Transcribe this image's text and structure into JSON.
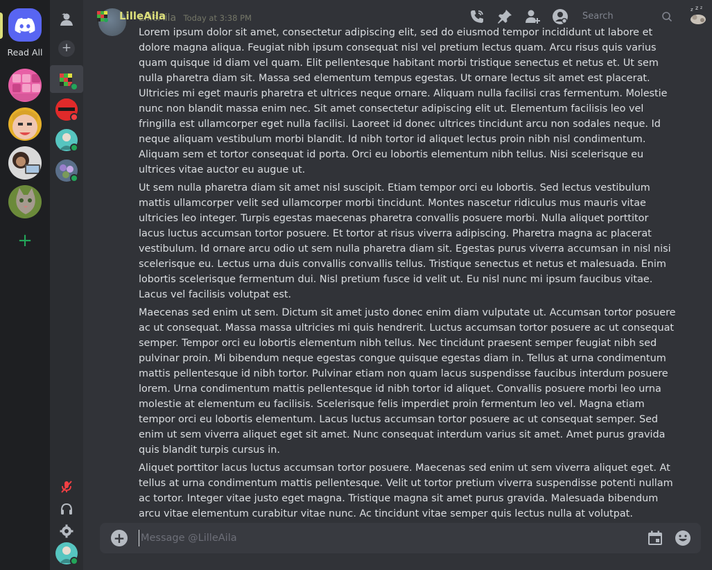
{
  "rail": {
    "read_all_label": "Read All",
    "accent": "#dbde7a",
    "brand": "#5865f2"
  },
  "header": {
    "username": "LilleAila",
    "search_placeholder": "Search",
    "icons": [
      "phone-call-icon",
      "pin-icon",
      "add-friend-icon",
      "profile-icon",
      "search-icon",
      "sleep-zz-icon"
    ]
  },
  "message": {
    "author": "LilleAila",
    "timestamp": "Today at 3:38 PM",
    "paragraphs": [
      "Lorem ipsum dolor sit amet, consectetur adipiscing elit, sed do eiusmod tempor incididunt ut labore et dolore magna aliqua. Feugiat nibh ipsum consequat nisl vel pretium lectus quam. Arcu risus quis varius quam quisque id diam vel quam. Elit pellentesque habitant morbi tristique senectus et netus et. Ut sem nulla pharetra diam sit. Massa sed elementum tempus egestas. Ut ornare lectus sit amet est placerat. Ultricies mi eget mauris pharetra et ultrices neque ornare. Aliquam nulla facilisi cras fermentum. Molestie nunc non blandit massa enim nec. Sit amet consectetur adipiscing elit ut. Elementum facilisis leo vel fringilla est ullamcorper eget nulla facilisi. Laoreet id donec ultrices tincidunt arcu non sodales neque. Id neque aliquam vestibulum morbi blandit. Id nibh tortor id aliquet lectus proin nibh nisl condimentum. Aliquam sem et tortor consequat id porta. Orci eu lobortis elementum nibh tellus. Nisi scelerisque eu ultrices vitae auctor eu augue ut.",
      "Ut sem nulla pharetra diam sit amet nisl suscipit. Etiam tempor orci eu lobortis. Sed lectus vestibulum mattis ullamcorper velit sed ullamcorper morbi tincidunt. Montes nascetur ridiculus mus mauris vitae ultricies leo integer. Turpis egestas maecenas pharetra convallis posuere morbi. Nulla aliquet porttitor lacus luctus accumsan tortor posuere. Et tortor at risus viverra adipiscing. Pharetra magna ac placerat vestibulum. Id ornare arcu odio ut sem nulla pharetra diam sit. Egestas purus viverra accumsan in nisl nisi scelerisque eu. Lectus urna duis convallis convallis tellus. Tristique senectus et netus et malesuada. Enim lobortis scelerisque fermentum dui. Nisl pretium fusce id velit ut. Eu nisl nunc mi ipsum faucibus vitae. Lacus vel facilisis volutpat est.",
      "Maecenas sed enim ut sem. Dictum sit amet justo donec enim diam vulputate ut. Accumsan tortor posuere ac ut consequat. Massa massa ultricies mi quis hendrerit. Luctus accumsan tortor posuere ac ut consequat semper. Tempor orci eu lobortis elementum nibh tellus. Nec tincidunt praesent semper feugiat nibh sed pulvinar proin. Mi bibendum neque egestas congue quisque egestas diam in. Tellus at urna condimentum mattis pellentesque id nibh tortor. Pulvinar etiam non quam lacus suspendisse faucibus interdum posuere lorem. Urna condimentum mattis pellentesque id nibh tortor id aliquet. Convallis posuere morbi leo urna molestie at elementum eu facilisis. Scelerisque felis imperdiet proin fermentum leo vel. Magna etiam tempor orci eu lobortis elementum. Lacus luctus accumsan tortor posuere ac ut consequat semper. Sed enim ut sem viverra aliquet eget sit amet. Nunc consequat interdum varius sit amet. Amet purus gravida quis blandit turpis cursus in.",
      "Aliquet porttitor lacus luctus accumsan tortor posuere. Maecenas sed enim ut sem viverra aliquet eget. At tellus at urna condimentum mattis pellentesque. Velit ut tortor pretium viverra suspendisse potenti nullam ac tortor. Integer vitae justo eget magna. Tristique magna sit amet purus gravida. Malesuada bibendum arcu vitae elementum curabitur vitae nunc. Ac tincidunt vitae semper quis lectus nulla at volutpat. Elementum nibh tellus molestie nunc non blandit massa enim nec. Nibh venenatis cras sed felis eget velit. Mauris cursus mattis molestie a iaculis at erat."
    ]
  },
  "composer": {
    "placeholder": "Message @LilleAila"
  },
  "colors": {
    "online": "#23a559",
    "dnd": "#f23f43",
    "muted_mic": "#f23f43"
  }
}
